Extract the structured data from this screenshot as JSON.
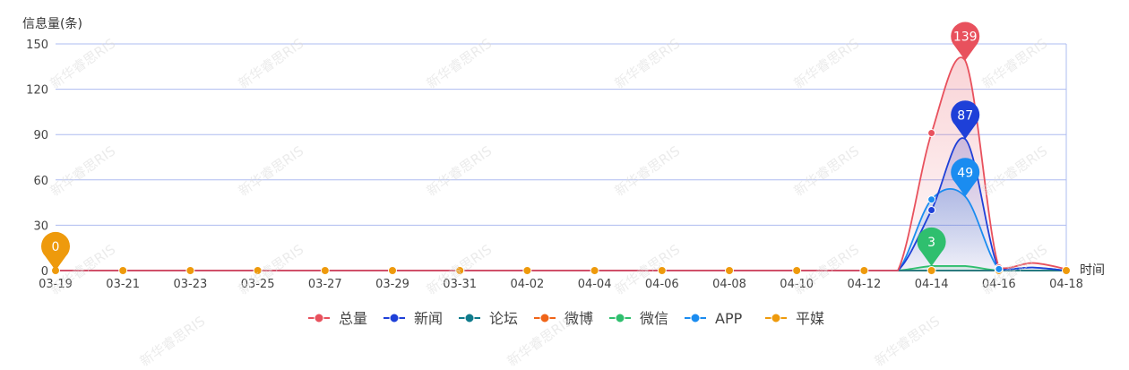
{
  "watermark": "新华睿思RIS",
  "chart_data": {
    "type": "area",
    "ylabel": "信息量(条)",
    "xlabel": "时间",
    "ylim": [
      0,
      150
    ],
    "yticks": [
      0,
      30,
      60,
      90,
      120,
      150
    ],
    "x": [
      "03-19",
      "03-20",
      "03-21",
      "03-22",
      "03-23",
      "03-24",
      "03-25",
      "03-26",
      "03-27",
      "03-28",
      "03-29",
      "03-30",
      "03-31",
      "04-01",
      "04-02",
      "04-03",
      "04-04",
      "04-05",
      "04-06",
      "04-07",
      "04-08",
      "04-09",
      "04-10",
      "04-11",
      "04-12",
      "04-13",
      "04-14",
      "04-15",
      "04-16",
      "04-17",
      "04-18"
    ],
    "xticks": [
      "03-19",
      "03-21",
      "03-23",
      "03-25",
      "03-27",
      "03-29",
      "03-31",
      "04-02",
      "04-04",
      "04-06",
      "04-08",
      "04-10",
      "04-12",
      "04-14",
      "04-16",
      "04-18"
    ],
    "grid": true,
    "legend_position": "bottom",
    "series": [
      {
        "name": "总量",
        "color": "#e8515d",
        "pin": {
          "at": "04-15",
          "value": 139
        },
        "values": [
          0,
          0,
          0,
          0,
          0,
          0,
          0,
          0,
          0,
          0,
          0,
          0,
          0,
          0,
          0,
          0,
          0,
          0,
          0,
          0,
          0,
          0,
          0,
          0,
          0,
          0,
          91,
          139,
          2,
          5,
          1
        ]
      },
      {
        "name": "新闻",
        "color": "#1e40d8",
        "pin": {
          "at": "04-15",
          "value": 87
        },
        "values": [
          0,
          0,
          0,
          0,
          0,
          0,
          0,
          0,
          0,
          0,
          0,
          0,
          0,
          0,
          0,
          0,
          0,
          0,
          0,
          0,
          0,
          0,
          0,
          0,
          0,
          0,
          40,
          87,
          1,
          2,
          0
        ]
      },
      {
        "name": "论坛",
        "color": "#0f7b8c",
        "pin": null,
        "values": [
          0,
          0,
          0,
          0,
          0,
          0,
          0,
          0,
          0,
          0,
          0,
          0,
          0,
          0,
          0,
          0,
          0,
          0,
          0,
          0,
          0,
          0,
          0,
          0,
          0,
          0,
          0,
          0,
          0,
          0,
          0
        ]
      },
      {
        "name": "微博",
        "color": "#f06418",
        "pin": null,
        "values": [
          0,
          0,
          0,
          0,
          0,
          0,
          0,
          0,
          0,
          0,
          0,
          0,
          0,
          0,
          0,
          0,
          0,
          0,
          0,
          0,
          0,
          0,
          0,
          0,
          0,
          0,
          0,
          0,
          0,
          0,
          0
        ]
      },
      {
        "name": "微信",
        "color": "#2fbf6e",
        "pin": {
          "at": "04-14",
          "value": 3
        },
        "values": [
          0,
          0,
          0,
          0,
          0,
          0,
          0,
          0,
          0,
          0,
          0,
          0,
          0,
          0,
          0,
          0,
          0,
          0,
          0,
          0,
          0,
          0,
          0,
          0,
          0,
          0,
          3,
          3,
          0,
          0,
          0
        ]
      },
      {
        "name": "APP",
        "color": "#1a8cf0",
        "pin": {
          "at": "04-15",
          "value": 49
        },
        "values": [
          0,
          0,
          0,
          0,
          0,
          0,
          0,
          0,
          0,
          0,
          0,
          0,
          0,
          0,
          0,
          0,
          0,
          0,
          0,
          0,
          0,
          0,
          0,
          0,
          0,
          0,
          47,
          49,
          1,
          2,
          0
        ]
      },
      {
        "name": "平媒",
        "color": "#ee9a0c",
        "pin": {
          "at": "03-19",
          "value": 0
        },
        "values": [
          0,
          0,
          0,
          0,
          0,
          0,
          0,
          0,
          0,
          0,
          0,
          0,
          0,
          0,
          0,
          0,
          0,
          0,
          0,
          0,
          0,
          0,
          0,
          0,
          0,
          0,
          0,
          0,
          0,
          0,
          0
        ]
      }
    ]
  }
}
